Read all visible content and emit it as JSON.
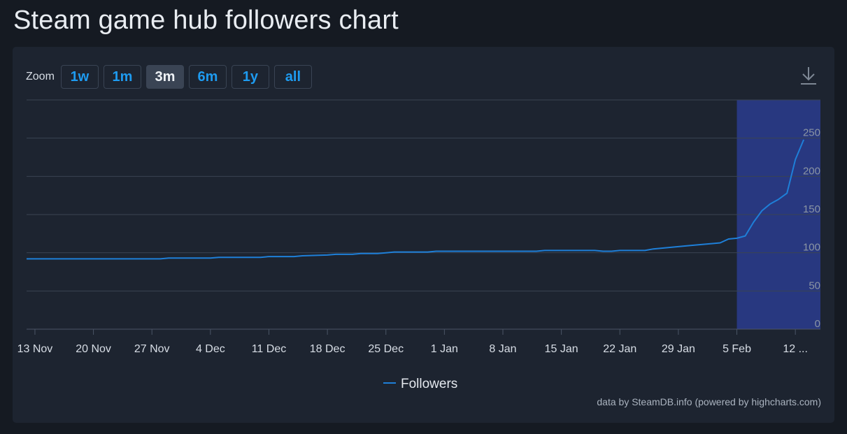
{
  "page": {
    "title": "Steam game hub followers chart"
  },
  "toolbar": {
    "zoom_label": "Zoom",
    "zoom_buttons": [
      "1w",
      "1m",
      "3m",
      "6m",
      "1y",
      "all"
    ],
    "active_zoom": "3m",
    "download_icon": "download-icon"
  },
  "credits": "data by SteamDB.info (powered by highcharts.com)",
  "colors": {
    "line": "#1e7fd8",
    "highlight_band": "#283880",
    "grid": "#3a4352",
    "background": "#1d2430"
  },
  "chart_data": {
    "type": "line",
    "title": "",
    "xlabel": "",
    "ylabel": "",
    "ylim": [
      0,
      300
    ],
    "yticks": [
      "0",
      "50",
      "100",
      "150",
      "200",
      "250"
    ],
    "xlim": [
      "2023-11-12",
      "2024-02-15"
    ],
    "xticks": [
      {
        "date": "2023-11-13",
        "label": "13 Nov"
      },
      {
        "date": "2023-11-20",
        "label": "20 Nov"
      },
      {
        "date": "2023-11-27",
        "label": "27 Nov"
      },
      {
        "date": "2023-12-04",
        "label": "4 Dec"
      },
      {
        "date": "2023-12-11",
        "label": "11 Dec"
      },
      {
        "date": "2023-12-18",
        "label": "18 Dec"
      },
      {
        "date": "2023-12-25",
        "label": "25 Dec"
      },
      {
        "date": "2024-01-01",
        "label": "1 Jan"
      },
      {
        "date": "2024-01-08",
        "label": "8 Jan"
      },
      {
        "date": "2024-01-15",
        "label": "15 Jan"
      },
      {
        "date": "2024-01-22",
        "label": "22 Jan"
      },
      {
        "date": "2024-01-29",
        "label": "29 Jan"
      },
      {
        "date": "2024-02-05",
        "label": "5 Feb"
      },
      {
        "date": "2024-02-12",
        "label": "12 ..."
      }
    ],
    "highlight_band": [
      "2024-02-05",
      "2024-02-15"
    ],
    "grid": true,
    "legend_position": "bottom-center",
    "series": [
      {
        "name": "Followers",
        "points": [
          [
            "2023-11-12",
            92
          ],
          [
            "2023-11-28",
            92
          ],
          [
            "2023-11-29",
            93
          ],
          [
            "2023-12-04",
            93
          ],
          [
            "2023-12-05",
            94
          ],
          [
            "2023-12-10",
            94
          ],
          [
            "2023-12-11",
            95
          ],
          [
            "2023-12-14",
            95
          ],
          [
            "2023-12-15",
            96
          ],
          [
            "2023-12-18",
            97
          ],
          [
            "2023-12-19",
            98
          ],
          [
            "2023-12-21",
            98
          ],
          [
            "2023-12-22",
            99
          ],
          [
            "2023-12-24",
            99
          ],
          [
            "2023-12-25",
            100
          ],
          [
            "2023-12-26",
            101
          ],
          [
            "2023-12-30",
            101
          ],
          [
            "2023-12-31",
            102
          ],
          [
            "2024-01-12",
            102
          ],
          [
            "2024-01-13",
            103
          ],
          [
            "2024-01-19",
            103
          ],
          [
            "2024-01-20",
            102
          ],
          [
            "2024-01-21",
            102
          ],
          [
            "2024-01-22",
            103
          ],
          [
            "2024-01-25",
            103
          ],
          [
            "2024-01-26",
            105
          ],
          [
            "2024-01-28",
            107
          ],
          [
            "2024-01-30",
            109
          ],
          [
            "2024-02-01",
            111
          ],
          [
            "2024-02-03",
            113
          ],
          [
            "2024-02-04",
            118
          ],
          [
            "2024-02-05",
            119
          ],
          [
            "2024-02-06",
            122
          ],
          [
            "2024-02-07",
            140
          ],
          [
            "2024-02-08",
            155
          ],
          [
            "2024-02-09",
            164
          ],
          [
            "2024-02-10",
            170
          ],
          [
            "2024-02-11",
            178
          ],
          [
            "2024-02-12",
            222
          ],
          [
            "2024-02-13",
            248
          ]
        ]
      }
    ]
  }
}
